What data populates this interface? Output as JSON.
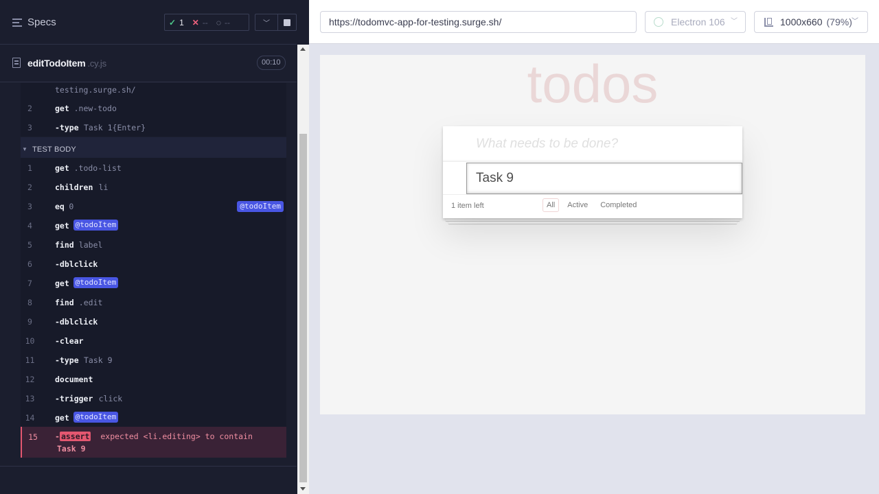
{
  "reporter": {
    "specs_label": "Specs",
    "stats": {
      "passed": "1",
      "failed": "--",
      "pending": "--",
      "passed_glyph": "✓",
      "failed_glyph": "✕",
      "pending_glyph": "◌"
    },
    "spec": {
      "name": "editTodoItem",
      "ext": ".cy.js",
      "duration": "00:10"
    },
    "before_commands": [
      {
        "num": "",
        "name": "",
        "msg": "testing.surge.sh/"
      },
      {
        "num": "2",
        "name": "get",
        "msg": ".new-todo"
      },
      {
        "num": "3",
        "name": "-type",
        "msg": "Task 1{Enter}"
      }
    ],
    "section_label": "TEST BODY",
    "commands": [
      {
        "num": "1",
        "name": "get",
        "msg": ".todo-list"
      },
      {
        "num": "2",
        "name": "children",
        "msg": "li"
      },
      {
        "num": "3",
        "name": "eq",
        "msg": "0",
        "alias_right": "@todoItem"
      },
      {
        "num": "4",
        "name": "get",
        "alias": "@todoItem"
      },
      {
        "num": "5",
        "name": "find",
        "msg": "label"
      },
      {
        "num": "6",
        "name": "-dblclick"
      },
      {
        "num": "7",
        "name": "get",
        "alias": "@todoItem"
      },
      {
        "num": "8",
        "name": "find",
        "msg": ".edit"
      },
      {
        "num": "9",
        "name": "-dblclick"
      },
      {
        "num": "10",
        "name": "-clear"
      },
      {
        "num": "11",
        "name": "-type",
        "msg": "Task 9"
      },
      {
        "num": "12",
        "name": "document"
      },
      {
        "num": "13",
        "name": "-trigger",
        "msg": "click"
      },
      {
        "num": "14",
        "name": "get",
        "alias": "@todoItem"
      }
    ],
    "failed_command": {
      "num": "15",
      "prefix": "-",
      "badge": "assert",
      "message": "expected <li.editing> to contain",
      "message_line2": "Task 9"
    }
  },
  "aut": {
    "url": "https://todomvc-app-for-testing.surge.sh/",
    "browser": "Electron 106",
    "viewport": "1000x660",
    "zoom": "(79%)",
    "app": {
      "title": "todos",
      "new_todo_placeholder": "What needs to be done?",
      "edit_value": "Task 9",
      "items_left": "1 item left",
      "filters": [
        "All",
        "Active",
        "Completed"
      ],
      "selected_filter": "All"
    }
  },
  "colors": {
    "reporter_bg": "#1b1e2e",
    "alias_bg": "#4956e3",
    "fail_accent": "#e45770",
    "pass": "#4fcb8c"
  }
}
